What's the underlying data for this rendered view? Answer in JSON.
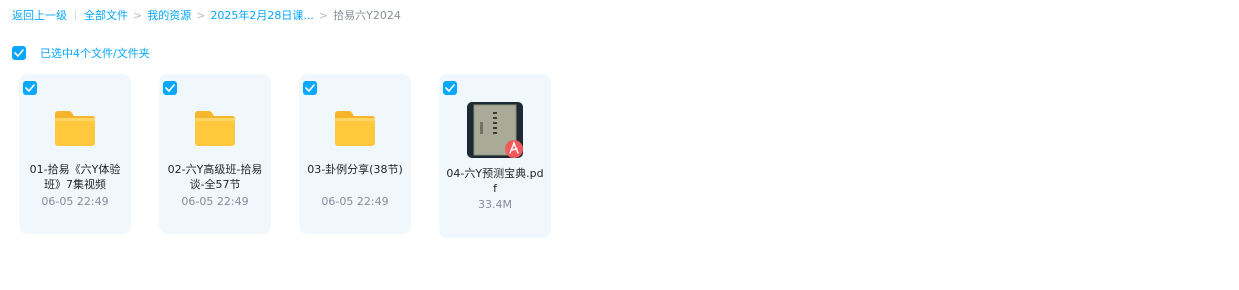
{
  "breadcrumb": {
    "back": "返回上一级",
    "items": [
      "全部文件",
      "我的资源",
      "2025年2月28日课..."
    ],
    "current": "拾易六Y2024"
  },
  "selection": {
    "checked": true,
    "text": "已选中4个文件/文件夹"
  },
  "files": [
    {
      "name": "01-拾易《六Y体验班》7集视频",
      "meta": "06-05 22:49",
      "type": "folder",
      "checked": true
    },
    {
      "name": "02-六Y高级班-拾易谈-全57节",
      "meta": "06-05 22:49",
      "type": "folder",
      "checked": true
    },
    {
      "name": "03-卦例分享(38节)",
      "meta": "06-05 22:49",
      "type": "folder",
      "checked": true
    },
    {
      "name": "04-六Y预测宝典.pdf",
      "meta": "33.4M",
      "type": "pdf",
      "checked": true
    }
  ],
  "colors": {
    "accent": "#06a7ff",
    "card_bg": "#f1f8fd",
    "folder": "#ffc83d",
    "pdf_badge": "#f25a5a"
  },
  "icons": {
    "folder": "folder-icon",
    "pdf": "pdf-file-icon",
    "check": "checkmark-icon"
  }
}
